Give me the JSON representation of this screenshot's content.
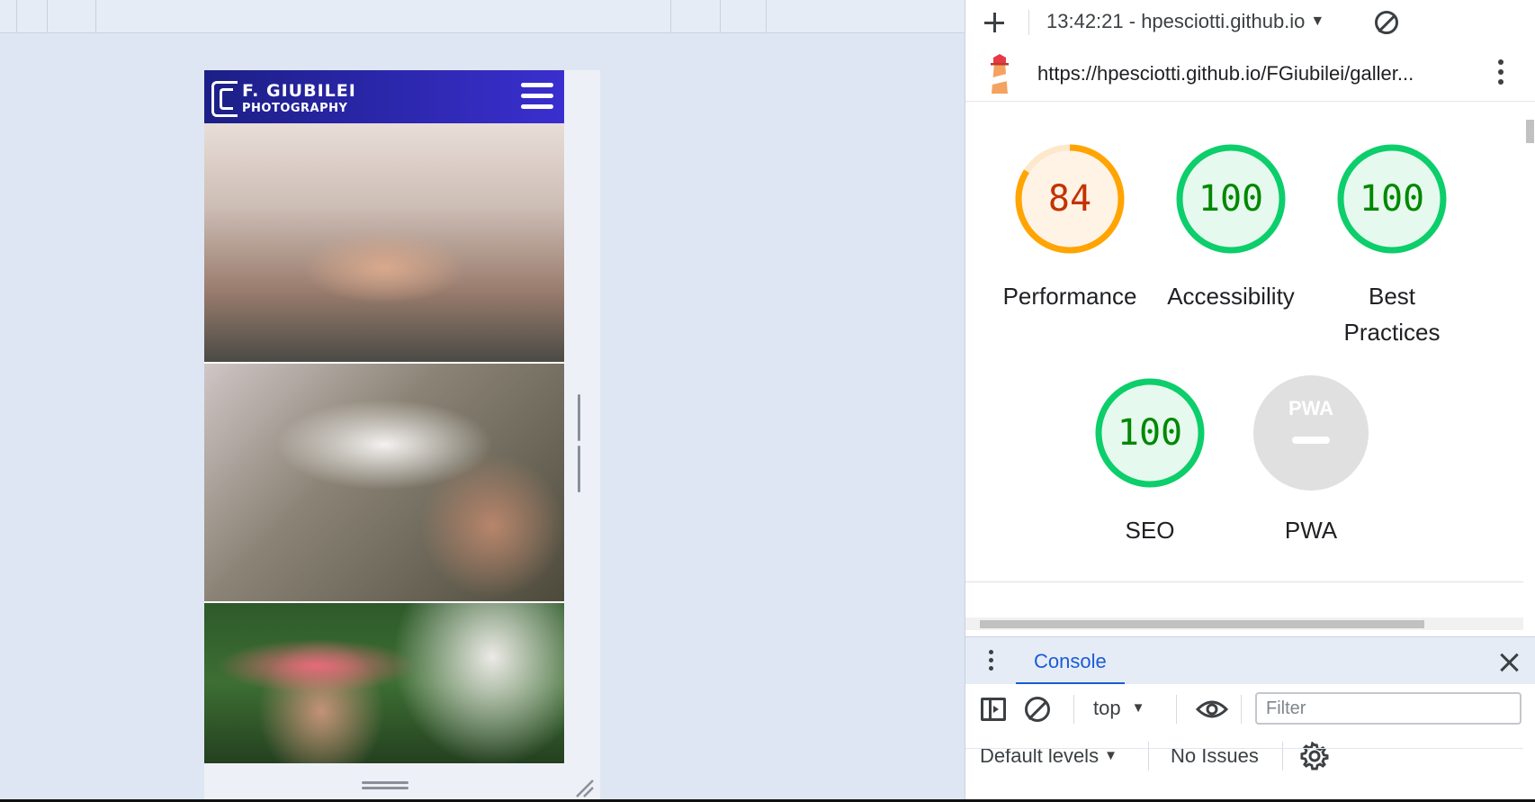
{
  "site": {
    "logo_line1": "F. GIUBILEI",
    "logo_line2": "PHOTOGRAPHY",
    "header_color": "#2a25b0"
  },
  "devtools": {
    "report_select": "13:42:21 - hpesciotti.github.io",
    "report_url": "https://hpesciotti.github.io/FGiubilei/galler...",
    "scores": {
      "performance": {
        "label": "Performance",
        "value": "84",
        "color": "#ffa400",
        "text_color": "#c33300",
        "fill": "#fff3e6"
      },
      "accessibility": {
        "label": "Accessibility",
        "value": "100",
        "color": "#0cce6b",
        "text_color": "#008800",
        "fill": "#e6f9ee"
      },
      "best_practices": {
        "label": "Best Practices",
        "value": "100",
        "color": "#0cce6b",
        "text_color": "#008800",
        "fill": "#e6f9ee"
      },
      "seo": {
        "label": "SEO",
        "value": "100",
        "color": "#0cce6b",
        "text_color": "#008800",
        "fill": "#e6f9ee"
      },
      "pwa": {
        "label": "PWA",
        "badge": "PWA",
        "color": "#e0e0e0"
      }
    },
    "drawer": {
      "tab_console": "Console",
      "context": "top",
      "filter_placeholder": "Filter",
      "levels": "Default levels",
      "issues": "No Issues"
    }
  }
}
